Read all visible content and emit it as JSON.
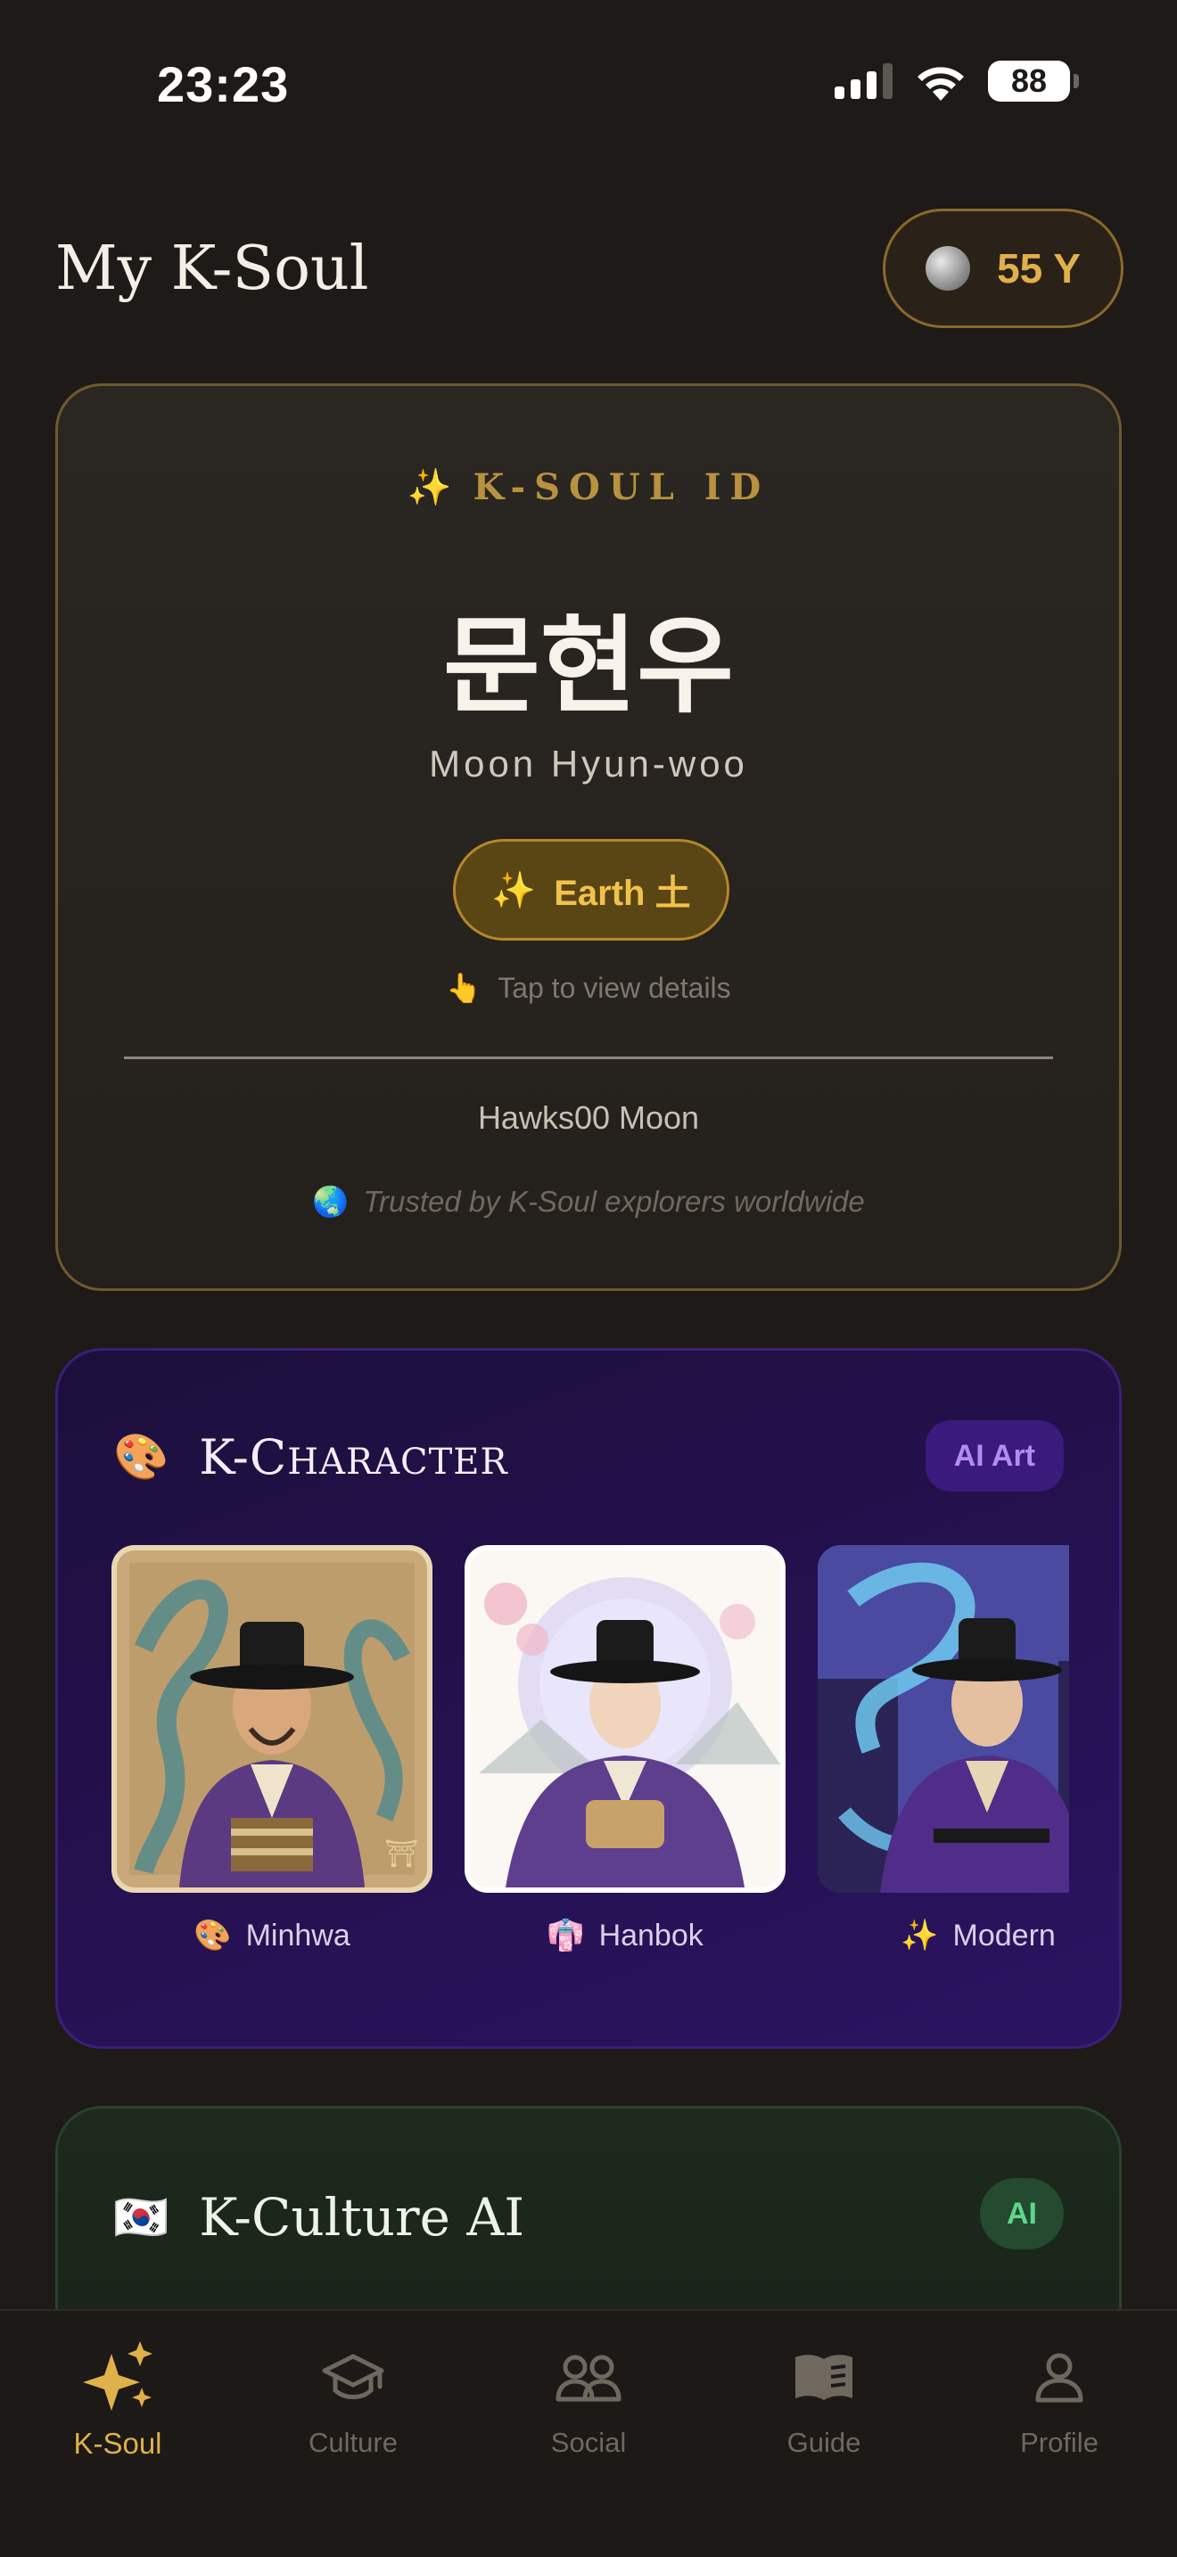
{
  "status_bar": {
    "time": "23:23",
    "battery": "88"
  },
  "header": {
    "title": "My K-Soul",
    "coin_value": "55 Y"
  },
  "id_card": {
    "label": "K-SOUL ID",
    "label_icon": "✨",
    "korean_name": "문현우",
    "roman_name": "Moon Hyun-woo",
    "element_icon": "✨",
    "element": "Earth 土",
    "tap_icon": "👆",
    "tap_hint": "Tap to view details",
    "user_handle": "Hawks00 Moon",
    "trusted_icon": "🌏",
    "trusted_text": "Trusted by K-Soul explorers worldwide"
  },
  "k_character": {
    "icon": "🎨",
    "title_first": "K-C",
    "title_rest": "HARACTER",
    "badge": "AI Art",
    "items": [
      {
        "icon": "🎨",
        "label": "Minhwa"
      },
      {
        "icon": "👘",
        "label": "Hanbok"
      },
      {
        "icon": "✨",
        "label": "Modern"
      }
    ]
  },
  "k_culture": {
    "icon": "🇰🇷",
    "title": "K-Culture AI",
    "badge": "AI"
  },
  "tabs": [
    {
      "label": "K-Soul",
      "icon": "sparkles-icon",
      "active": true
    },
    {
      "label": "Culture",
      "icon": "graduation-cap-icon",
      "active": false
    },
    {
      "label": "Social",
      "icon": "people-icon",
      "active": false
    },
    {
      "label": "Guide",
      "icon": "book-icon",
      "active": false
    },
    {
      "label": "Profile",
      "icon": "person-icon",
      "active": false
    }
  ],
  "colors": {
    "accent_gold": "#e0b04a",
    "purple_card": "#251150",
    "green_card": "#1d2a1d",
    "background": "#1d1a17"
  }
}
